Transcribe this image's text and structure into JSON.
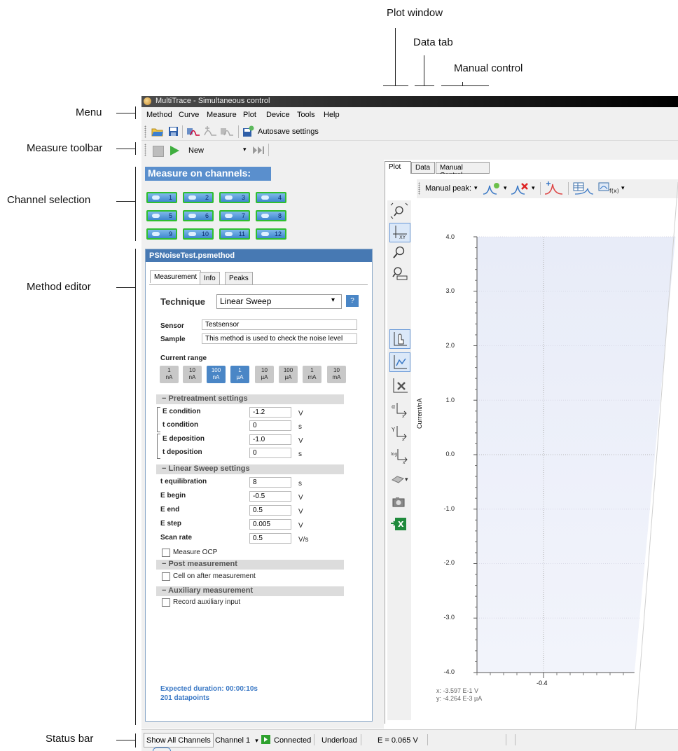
{
  "annotations": {
    "plot_window": "Plot window",
    "data_tab": "Data tab",
    "manual_control": "Manual control",
    "menu": "Menu",
    "measure_toolbar": "Measure toolbar",
    "channel_selection": "Channel selection",
    "method_editor": "Method editor",
    "status_bar": "Status bar"
  },
  "window": {
    "title": "MultiTrace - Simultaneous control"
  },
  "menu": [
    "Method",
    "Curve",
    "Measure",
    "Plot",
    "Device",
    "Tools",
    "Help"
  ],
  "toolbar": {
    "autosave_label": "Autosave settings"
  },
  "measure_toolbar": {
    "method_select": "New"
  },
  "channels": {
    "header": "Measure on channels:",
    "items": [
      "1",
      "2",
      "3",
      "4",
      "5",
      "6",
      "7",
      "8",
      "9",
      "10",
      "11",
      "12"
    ]
  },
  "method": {
    "filename": "PSNoiseTest.psmethod",
    "tabs": [
      "Measurement",
      "Info",
      "Peaks"
    ],
    "technique_label": "Technique",
    "technique_value": "Linear Sweep",
    "help_button": "?",
    "sensor_label": "Sensor",
    "sensor_value": "Testsensor",
    "sample_label": "Sample",
    "sample_value": "This method is used to check the noise level",
    "current_range_label": "Current range",
    "current_ranges": [
      {
        "v": "1",
        "u": "nA"
      },
      {
        "v": "10",
        "u": "nA"
      },
      {
        "v": "100",
        "u": "nA"
      },
      {
        "v": "1",
        "u": "µA"
      },
      {
        "v": "10",
        "u": "µA"
      },
      {
        "v": "100",
        "u": "µA"
      },
      {
        "v": "1",
        "u": "mA"
      },
      {
        "v": "10",
        "u": "mA"
      }
    ],
    "pretreatment_header": "−   Pretreatment settings",
    "e_condition_label": "E condition",
    "e_condition": "-1.2",
    "e_condition_unit": "V",
    "t_condition_label": "t condition",
    "t_condition": "0",
    "t_condition_unit": "s",
    "e_deposition_label": "E deposition",
    "e_deposition": "-1.0",
    "e_deposition_unit": "V",
    "t_deposition_label": "t deposition",
    "t_deposition": "0",
    "t_deposition_unit": "s",
    "lsv_header": "−   Linear Sweep settings",
    "t_equil_label": "t equilibration",
    "t_equil": "8",
    "t_equil_unit": "s",
    "e_begin_label": "E begin",
    "e_begin": "-0.5",
    "e_begin_unit": "V",
    "e_end_label": "E end",
    "e_end": "0.5",
    "e_end_unit": "V",
    "e_step_label": "E step",
    "e_step": "0.005",
    "e_step_unit": "V",
    "scan_rate_label": "Scan rate",
    "scan_rate": "0.5",
    "scan_rate_unit": "V/s",
    "measure_ocp": "Measure OCP",
    "post_header": "−   Post measurement",
    "cell_on": "Cell on after measurement",
    "aux_header": "−   Auxiliary measurement",
    "record_aux": "Record auxiliary input",
    "expected_duration": "Expected duration: 00:00:10s",
    "datapoints": "201 datapoints"
  },
  "plot": {
    "tabs": [
      "Plot",
      "Data",
      "Manual Control"
    ],
    "manual_peak_label": "Manual peak:",
    "y_axis_label": "Current/nA",
    "y_ticks": [
      "4.0",
      "3.0",
      "2.0",
      "1.0",
      "0.0",
      "-1.0",
      "-2.0",
      "-3.0",
      "-4.0"
    ],
    "x_tick": "-0.4",
    "cursor_x": "x: -3.597 E-1 V",
    "cursor_y": "y: -4.264 E-3 µA"
  },
  "status": {
    "show_all": "Show All Channels",
    "channel": "Channel 1",
    "connected": "Connected",
    "underload": "Underload",
    "potential": "E = 0.065 V"
  }
}
